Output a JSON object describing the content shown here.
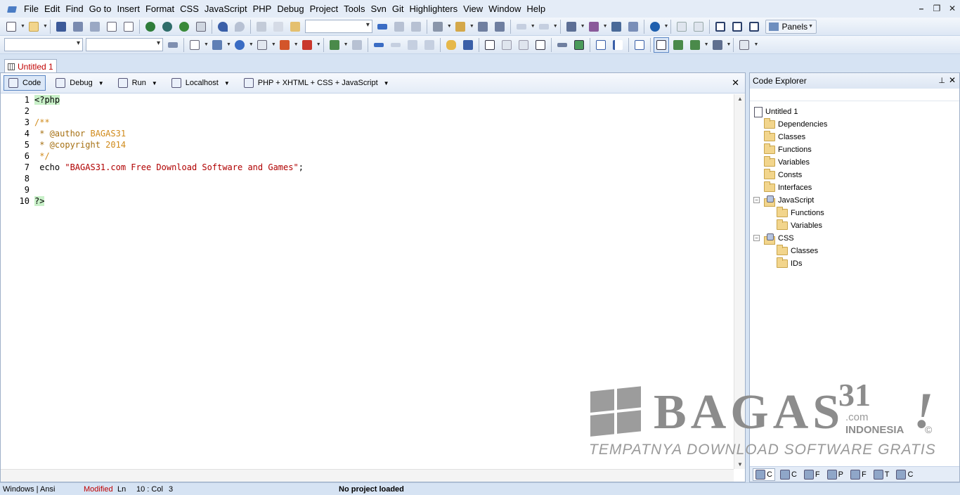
{
  "menu": [
    "File",
    "Edit",
    "Find",
    "Go to",
    "Insert",
    "Format",
    "CSS",
    "JavaScript",
    "PHP",
    "Debug",
    "Project",
    "Tools",
    "Svn",
    "Git",
    "Highlighters",
    "View",
    "Window",
    "Help"
  ],
  "window_controls": {
    "minimize": "–",
    "restore": "❐",
    "close": "✕"
  },
  "toolbar": {
    "panels_label": "Panels"
  },
  "tab": {
    "title": "Untitled 1"
  },
  "editor_toolbar": {
    "code": "Code",
    "debug": "Debug",
    "run": "Run",
    "localhost": "Localhost",
    "language": "PHP + XHTML + CSS + JavaScript",
    "close": "✕"
  },
  "code_lines": [
    {
      "n": "1",
      "text": "<?php",
      "cls": "tag"
    },
    {
      "n": "2",
      "text": "",
      "cls": ""
    },
    {
      "n": "3",
      "text": "/**",
      "cls": "cmt"
    },
    {
      "n": "4",
      "pre": " * @author ",
      "val": "BAGAS31",
      "cls": "doc"
    },
    {
      "n": "5",
      "pre": " * @copyright ",
      "val": "2014",
      "cls": "doc"
    },
    {
      "n": "6",
      "text": " */",
      "cls": "cmt"
    },
    {
      "n": "7",
      "pre": " echo ",
      "str": "\"BAGAS31.com Free Download Software and Games\"",
      "post": ";",
      "cls": "echo"
    },
    {
      "n": "8",
      "text": "",
      "cls": ""
    },
    {
      "n": "9",
      "text": "",
      "cls": ""
    },
    {
      "n": "10",
      "text": "?>",
      "cls": "tag"
    }
  ],
  "explorer": {
    "title": "Code Explorer",
    "root": "Untitled 1",
    "php_items": [
      "Dependencies",
      "Classes",
      "Functions",
      "Variables",
      "Consts",
      "Interfaces"
    ],
    "javascript": {
      "label": "JavaScript",
      "items": [
        "Functions",
        "Variables"
      ]
    },
    "css": {
      "label": "CSS",
      "items": [
        "Classes",
        "IDs"
      ]
    },
    "bottom_tabs": [
      "C",
      "C",
      "F",
      "P",
      "F",
      "T",
      "C"
    ]
  },
  "watermark": {
    "brand": "BAGAS",
    "number": "31",
    "com": ".com",
    "country": "INDONESIA",
    "excl": "!",
    "copy": "©",
    "tagline": "TEMPATNYA DOWNLOAD SOFTWARE GRATIS"
  },
  "status": {
    "encoding": "Windows | Ansi",
    "modified": "Modified",
    "ln": "Ln",
    "pos": "10 : Col",
    "col": "3",
    "project": "No project loaded"
  },
  "colors": {
    "modified": "#c00000",
    "comment": "#d08a1a",
    "string": "#b00000",
    "php_tag_bg": "#c8f0c8",
    "accent": "#d6e3f3"
  }
}
